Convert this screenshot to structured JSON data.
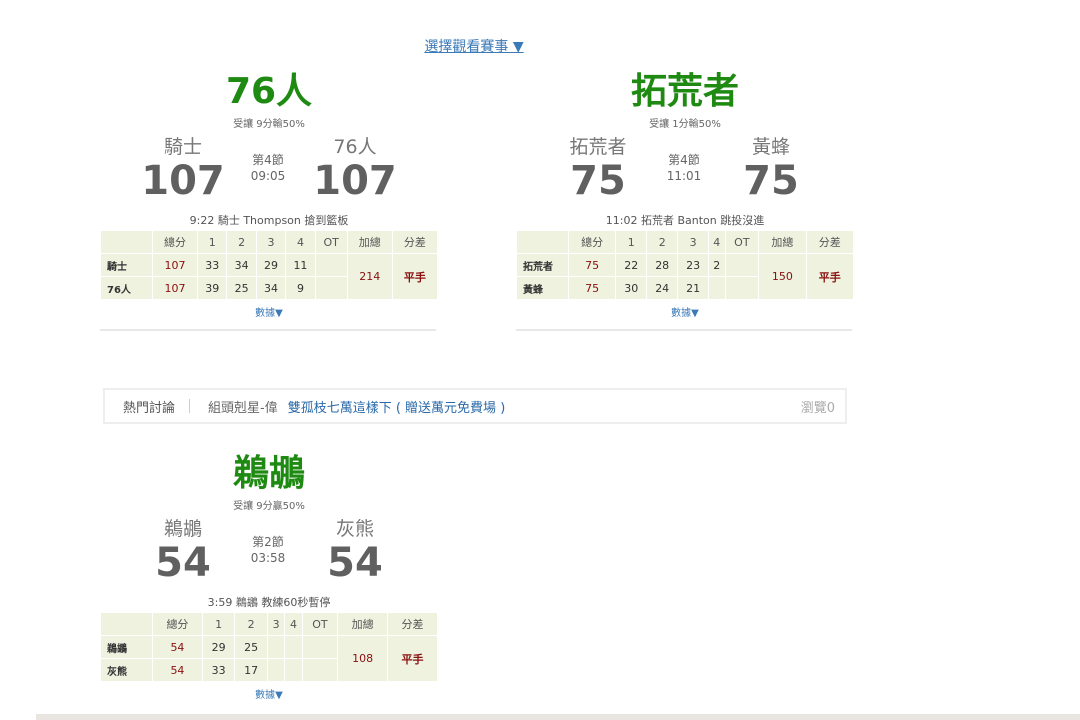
{
  "select_game_label": "選擇觀看賽事 ▼",
  "games": [
    {
      "headline": "76人",
      "odds": "受讓 9分輸50%",
      "away_name": "騎士",
      "away_score": "107",
      "home_name": "76人",
      "home_score": "107",
      "period": "第4節",
      "clock": "09:05",
      "last_play": "9:22 騎士 Thompson 搶到籃板",
      "headers": [
        "總分",
        "1",
        "2",
        "3",
        "4",
        "OT",
        "加總",
        "分差"
      ],
      "rows": [
        {
          "team": "騎士",
          "total": "107",
          "q1": "33",
          "q2": "34",
          "q3": "29",
          "q4": "11",
          "ot": ""
        },
        {
          "team": "76人",
          "total": "107",
          "q1": "39",
          "q2": "25",
          "q3": "34",
          "q4": "9",
          "ot": ""
        }
      ],
      "sum": "214",
      "diff": "平手",
      "more": "數據▼"
    },
    {
      "headline": "拓荒者",
      "odds": "受讓 1分輸50%",
      "away_name": "拓荒者",
      "away_score": "75",
      "home_name": "黃蜂",
      "home_score": "75",
      "period": "第4節",
      "clock": "11:01",
      "last_play": "11:02 拓荒者 Banton 跳投沒進",
      "headers": [
        "總分",
        "1",
        "2",
        "3",
        "4",
        "OT",
        "加總",
        "分差"
      ],
      "rows": [
        {
          "team": "拓荒者",
          "total": "75",
          "q1": "22",
          "q2": "28",
          "q3": "23",
          "q4": "2",
          "ot": ""
        },
        {
          "team": "黃蜂",
          "total": "75",
          "q1": "30",
          "q2": "24",
          "q3": "21",
          "q4": "",
          "ot": ""
        }
      ],
      "sum": "150",
      "diff": "平手",
      "more": "數據▼"
    },
    {
      "headline": "鵜鶘",
      "odds": "受讓 9分贏50%",
      "away_name": "鵜鶘",
      "away_score": "54",
      "home_name": "灰熊",
      "home_score": "54",
      "period": "第2節",
      "clock": "03:58",
      "last_play": "3:59 鵜鶘 教練60秒暫停",
      "headers": [
        "總分",
        "1",
        "2",
        "3",
        "4",
        "OT",
        "加總",
        "分差"
      ],
      "rows": [
        {
          "team": "鵜鶘",
          "total": "54",
          "q1": "29",
          "q2": "25",
          "q3": "",
          "q4": "",
          "ot": ""
        },
        {
          "team": "灰熊",
          "total": "54",
          "q1": "33",
          "q2": "17",
          "q3": "",
          "q4": "",
          "ot": ""
        }
      ],
      "sum": "108",
      "diff": "平手",
      "more": "數據▼"
    }
  ],
  "hot": {
    "label": "熱門討論",
    "author": "組頭剋星-偉",
    "topic": "雙孤枝七萬這樣下 ( 贈送萬元免費場 )",
    "views": "瀏覽0"
  }
}
